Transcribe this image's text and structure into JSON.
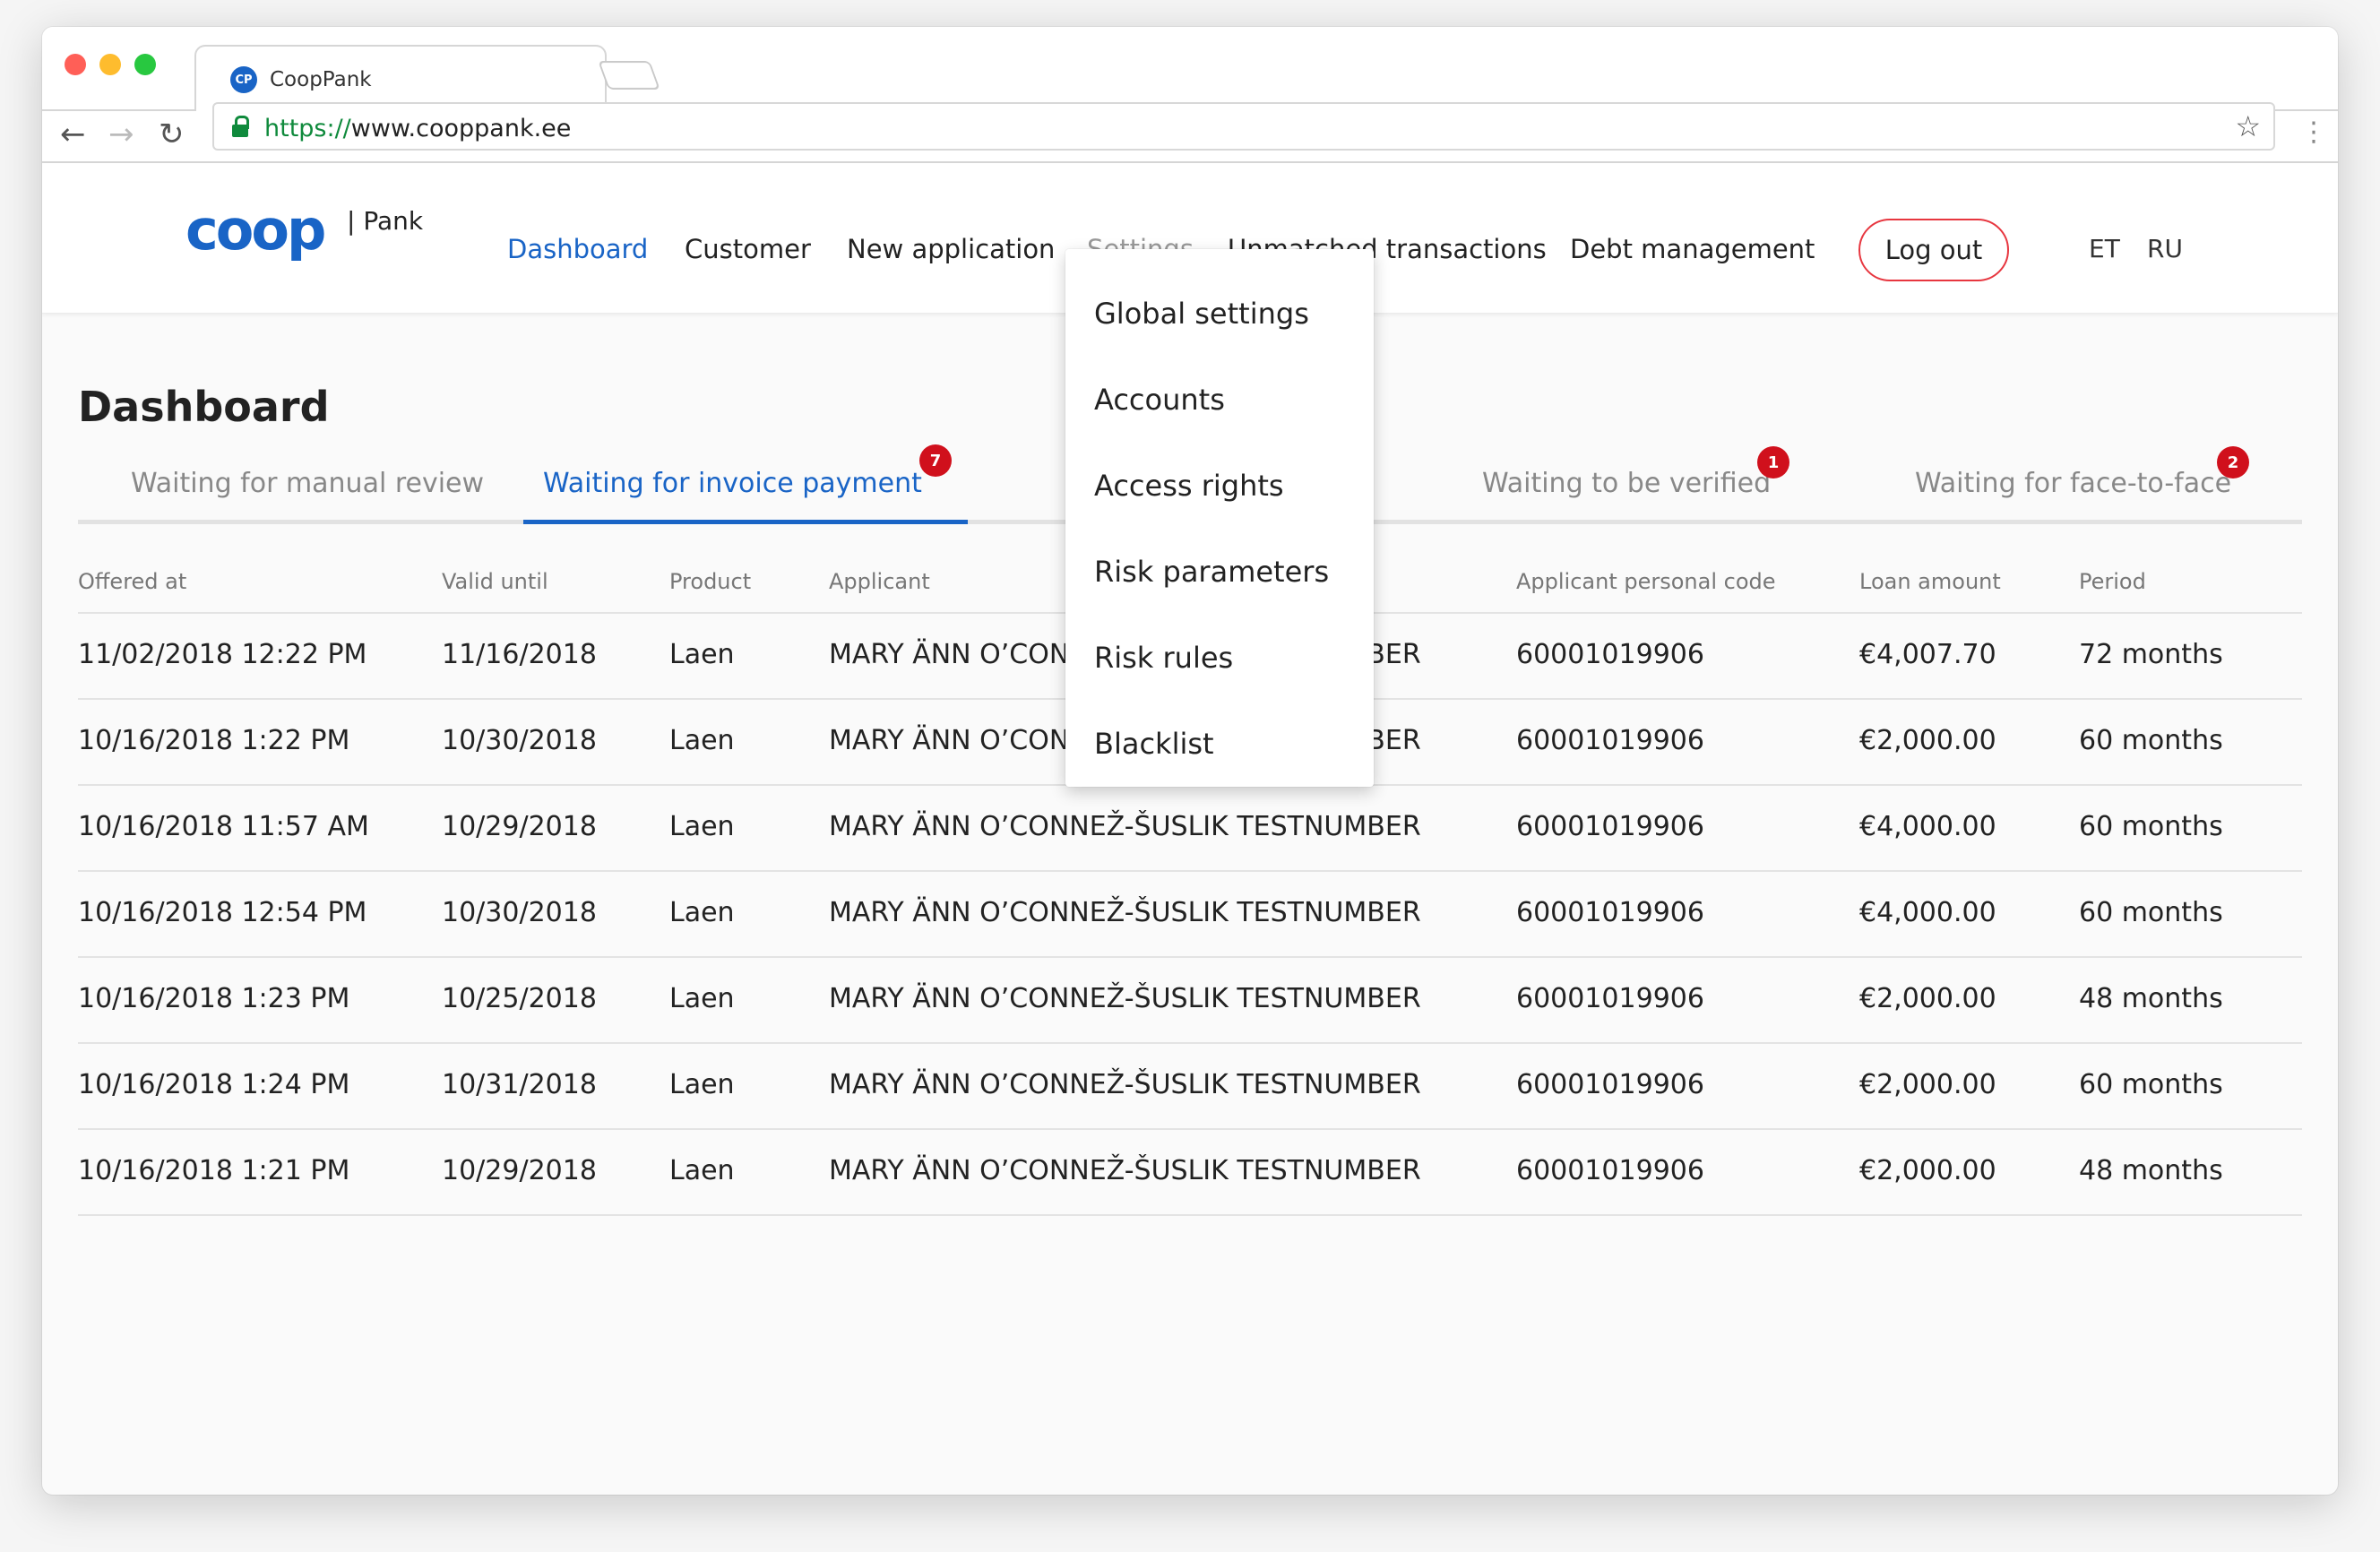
{
  "browser": {
    "tab_title": "CoopPank",
    "tab_icon_text": "CP",
    "url_scheme": "https://",
    "url_host": "www.cooppank.ee"
  },
  "header": {
    "logo_text": "coop",
    "logo_sub": "| Pank",
    "nav": [
      "Dashboard",
      "Customer",
      "New application",
      "Settings",
      "Unmatched transactions",
      "Debt management"
    ],
    "logout_label": "Log out",
    "languages": [
      "ET",
      "RU"
    ]
  },
  "settings_menu": [
    "Global settings",
    "Accounts",
    "Access rights",
    "Risk parameters",
    "Risk rules",
    "Blacklist"
  ],
  "page": {
    "title": "Dashboard",
    "tabs": [
      {
        "label": "Waiting for manual review",
        "badge": ""
      },
      {
        "label": "Waiting for invoice payment",
        "badge": "7"
      },
      {
        "label": "Waiting to be verified",
        "badge": "1"
      },
      {
        "label": "Waiting for face-to-face",
        "badge": "2"
      }
    ]
  },
  "table": {
    "columns": [
      "Offered at",
      "Valid until",
      "Product",
      "Applicant",
      "Applicant personal code",
      "Loan amount",
      "Period"
    ],
    "rows": [
      {
        "offered": "11/02/2018 12:22 PM",
        "valid": "11/16/2018",
        "product": "Laen",
        "applicant": "MARY ÄNN O’CONNEŽ-ŠUSLIK TESTNUMBER",
        "code": "60001019906",
        "amount": "€4,007.70",
        "period": "72 months"
      },
      {
        "offered": "10/16/2018 1:22 PM",
        "valid": "10/30/2018",
        "product": "Laen",
        "applicant": "MARY ÄNN O’CONNEŽ-ŠUSLIK TESTNUMBER",
        "code": "60001019906",
        "amount": "€2,000.00",
        "period": "60 months"
      },
      {
        "offered": "10/16/2018 11:57 AM",
        "valid": "10/29/2018",
        "product": "Laen",
        "applicant": "MARY ÄNN O’CONNEŽ-ŠUSLIK TESTNUMBER",
        "code": "60001019906",
        "amount": "€4,000.00",
        "period": "60 months"
      },
      {
        "offered": "10/16/2018 12:54 PM",
        "valid": "10/30/2018",
        "product": "Laen",
        "applicant": "MARY ÄNN O’CONNEŽ-ŠUSLIK TESTNUMBER",
        "code": "60001019906",
        "amount": "€4,000.00",
        "period": "60 months"
      },
      {
        "offered": "10/16/2018 1:23 PM",
        "valid": "10/25/2018",
        "product": "Laen",
        "applicant": "MARY ÄNN O’CONNEŽ-ŠUSLIK TESTNUMBER",
        "code": "60001019906",
        "amount": "€2,000.00",
        "period": "48 months"
      },
      {
        "offered": "10/16/2018 1:24 PM",
        "valid": "10/31/2018",
        "product": "Laen",
        "applicant": "MARY ÄNN O’CONNEŽ-ŠUSLIK TESTNUMBER",
        "code": "60001019906",
        "amount": "€2,000.00",
        "period": "60 months"
      },
      {
        "offered": "10/16/2018 1:21 PM",
        "valid": "10/29/2018",
        "product": "Laen",
        "applicant": "MARY ÄNN O’CONNEŽ-ŠUSLIK TESTNUMBER",
        "code": "60001019906",
        "amount": "€2,000.00",
        "period": "48 months"
      }
    ]
  },
  "colors": {
    "brand_blue": "#1964c6",
    "badge_red": "#d0101c",
    "logout_border": "#e7363f"
  }
}
